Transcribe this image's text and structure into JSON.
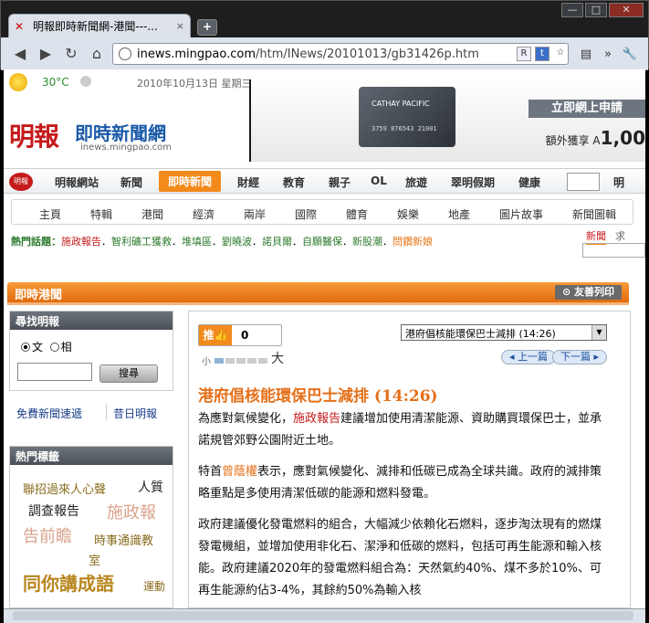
{
  "browser": {
    "tab_title": "明報即時新聞網-港聞---...",
    "tab_close": "×",
    "new_tab": "+",
    "window_min": "—",
    "window_max": "□",
    "window_close": "✕",
    "url_host": "inews.mingpao.com",
    "url_path": "/htm/INews/20101013/gb31426p.htm"
  },
  "header": {
    "temperature": "30°C",
    "date": "2010年10月13日 星期三",
    "logo_brand": "明報",
    "logo_site": "即時新聞網",
    "logo_host": "inews.mingpao.com",
    "ad_card_brand": "CATHAY PACIFIC",
    "ad_card_number": "3759 876543 21001",
    "ad_apply": "立即網上申請",
    "ad_offer_prefix": "額外獲享",
    "ad_offer_value": "1,00"
  },
  "nav_main": [
    "明報網站",
    "新聞",
    "即時新聞",
    "財經",
    "教育",
    "親子",
    "OL",
    "旅遊",
    "翠明假期",
    "健康",
    "明"
  ],
  "nav_active_index": 2,
  "nav_sub": [
    "主頁",
    "特輯",
    "港聞",
    "經濟",
    "兩岸",
    "國際",
    "體育",
    "娛樂",
    "地產",
    "圖片故事",
    "新聞圖輯"
  ],
  "hot_topics": {
    "label": "熱門話題：",
    "items": [
      {
        "text": "施政報告",
        "color": "red"
      },
      {
        "text": "智利礦工獲救",
        "color": "green"
      },
      {
        "text": "堆填區",
        "color": "green"
      },
      {
        "text": "劉曉波",
        "color": "green"
      },
      {
        "text": "諾貝爾",
        "color": "green"
      },
      {
        "text": "自願醫保",
        "color": "green"
      },
      {
        "text": "新股潮",
        "color": "green"
      },
      {
        "text": "問鑽新娘",
        "color": "orange"
      }
    ],
    "separator": "．"
  },
  "search_tabs": {
    "news": "新聞",
    "other": "求"
  },
  "section": {
    "title": "即時港聞",
    "print": "⊙ 友善列印"
  },
  "find": {
    "title": "尋找明報",
    "radio_text": "文",
    "radio_image": "相",
    "button": "搜尋",
    "link_free": "免費新聞速遞",
    "link_past": "昔日明報"
  },
  "hot_tags": {
    "title": "熱門標籤",
    "words": [
      {
        "text": "聯招過來人心聲",
        "color": "#8a6d1e",
        "size": 13
      },
      {
        "text": "人質",
        "color": "#222222",
        "size": 14
      },
      {
        "text": "調查報告",
        "color": "#222222",
        "size": 14
      },
      {
        "text": "施政報",
        "color": "#d9a28a",
        "size": 18
      },
      {
        "text": "告前瞻",
        "color": "#d9a28a",
        "size": 18
      },
      {
        "text": "時事通識教",
        "color": "#8a6d1e",
        "size": 13
      },
      {
        "text": "室",
        "color": "#8a6d1e",
        "size": 13
      },
      {
        "text": "同你講成語",
        "color": "#b8861e",
        "size": 20
      },
      {
        "text": "運動",
        "color": "#8a6d1e",
        "size": 12
      }
    ]
  },
  "article": {
    "like_label": "推",
    "like_count": "0",
    "font_small": "小",
    "font_large": "大",
    "selector_value": "港府倡核能環保巴士減排 (14:26)",
    "prev": "上一篇",
    "next": "下一篇",
    "headline": "港府倡核能環保巴士減排 (14:26)",
    "p1_a": "為應對氣候變化，",
    "p1_link": "施政報告",
    "p1_b": "建議增加使用清潔能源、資助購買環保巴士，並承諾規管郊野公園附近土地。",
    "p2_a": "特首",
    "p2_link": "曾蔭權",
    "p2_b": "表示，應對氣候變化、減排和低碳已成為全球共識。政府的減排策略重點是多使用清潔低碳的能源和燃料發電。",
    "p3": "政府建議優化發電燃料的組合，大幅減少依賴化石燃料，逐步淘汰現有的燃煤發電機組，並增加使用非化石、潔淨和低碳的燃料，包括可再生能源和輸入核能。政府建議2020年的發電燃料組合為：天然氣約40%、煤不多於10%、可再生能源約佔3-4%，其餘約50%為輸入核"
  }
}
